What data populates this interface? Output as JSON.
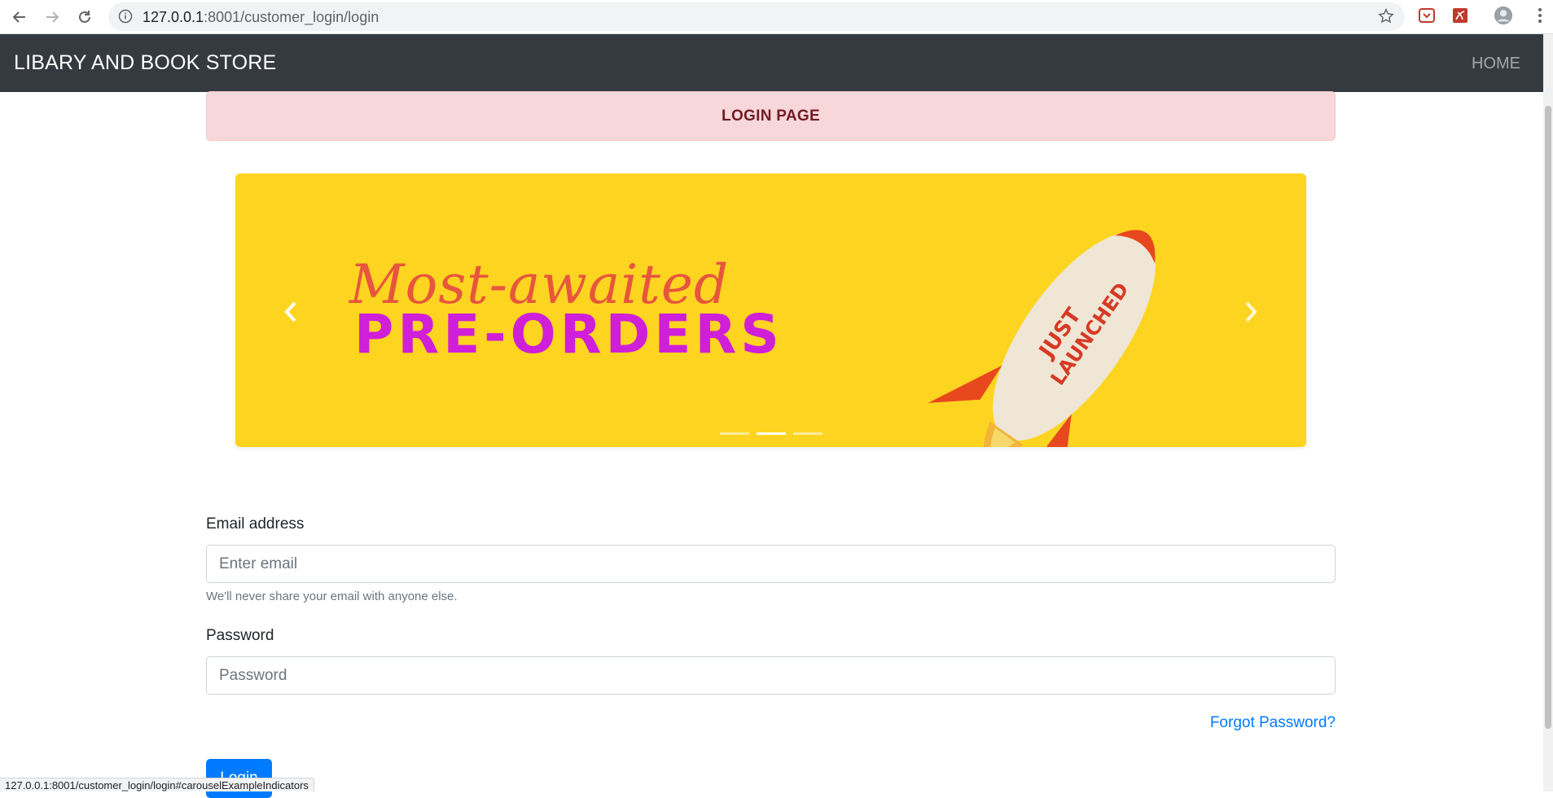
{
  "browser": {
    "url_host": "127.0.0.1",
    "url_path": ":8001/customer_login/login",
    "status_url": "127.0.0.1:8001/customer_login/login#carouselExampleIndicators"
  },
  "navbar": {
    "brand": "LIBARY AND BOOK STORE",
    "home": "HOME"
  },
  "alert": {
    "title": "LOGIN PAGE"
  },
  "carousel": {
    "headline_script": "Most-awaited",
    "headline_main": "PRE-ORDERS",
    "badge": "JUST LAUNCHED",
    "slides": 3,
    "active_slide": 2
  },
  "form": {
    "email_label": "Email address",
    "email_placeholder": "Enter email",
    "email_help": "We'll never share your email with anyone else.",
    "password_label": "Password",
    "password_placeholder": "Password",
    "forgot": "Forgot Password?",
    "submit": "Login"
  }
}
